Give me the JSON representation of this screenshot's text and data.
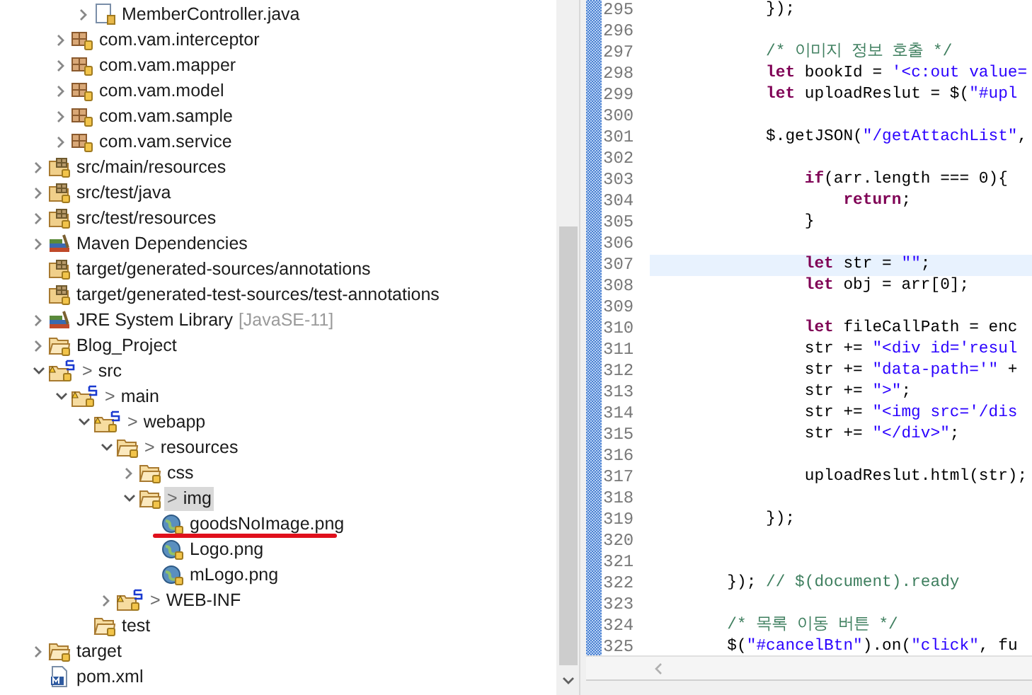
{
  "explorer": {
    "items": [
      {
        "children": [
          {
            "children": [
              {
                "children": [
                  {
                    "label": "MemberController.java",
                    "kind": "java",
                    "expanded": false,
                    "selected": false
                  }
                ]
              },
              {
                "label": "com.vam.interceptor",
                "kind": "package",
                "expanded": false,
                "selected": false
              },
              {
                "label": "com.vam.mapper",
                "kind": "package",
                "expanded": false,
                "selected": false
              },
              {
                "label": "com.vam.model",
                "kind": "package",
                "expanded": false,
                "selected": false
              },
              {
                "label": "com.vam.sample",
                "kind": "package",
                "expanded": false,
                "selected": false
              },
              {
                "label": "com.vam.service",
                "kind": "package",
                "expanded": false,
                "selected": false
              }
            ]
          },
          {
            "label": "src/main/resources",
            "kind": "source-folder",
            "expanded": false,
            "selected": false
          },
          {
            "label": "src/test/java",
            "kind": "source-folder",
            "expanded": false,
            "selected": false
          },
          {
            "label": "src/test/resources",
            "kind": "source-folder",
            "expanded": false,
            "selected": false
          },
          {
            "label": "Maven Dependencies",
            "kind": "library",
            "expanded": false,
            "selected": false
          },
          {
            "label": "target/generated-sources/annotations",
            "kind": "source-folder",
            "selected": false
          },
          {
            "label": "target/generated-test-sources/test-annotations",
            "kind": "source-folder",
            "selected": false
          },
          {
            "label": "JRE System Library",
            "decoration": "[JavaSE-11]",
            "kind": "library",
            "expanded": false,
            "selected": false
          },
          {
            "label": "Blog_Project",
            "kind": "folder",
            "expanded": false,
            "selected": false
          },
          {
            "label": "src",
            "prefix": ">",
            "kind": "web-folder",
            "expanded": true,
            "selected": false,
            "children": [
              {
                "label": "main",
                "prefix": ">",
                "kind": "web-folder",
                "expanded": true,
                "selected": false,
                "children": [
                  {
                    "label": "webapp",
                    "prefix": ">",
                    "kind": "web-folder",
                    "expanded": true,
                    "selected": false,
                    "children": [
                      {
                        "label": "resources",
                        "prefix": ">",
                        "kind": "folder",
                        "expanded": true,
                        "selected": false,
                        "children": [
                          {
                            "label": "css",
                            "kind": "folder",
                            "expanded": false,
                            "selected": false
                          },
                          {
                            "label": "img",
                            "prefix": ">",
                            "kind": "folder",
                            "expanded": true,
                            "selected": true,
                            "children": [
                              {
                                "label": "goodsNoImage.png",
                                "kind": "image",
                                "selected": false,
                                "annotated": true
                              },
                              {
                                "label": "Logo.png",
                                "kind": "image",
                                "selected": false
                              },
                              {
                                "label": "mLogo.png",
                                "kind": "image",
                                "selected": false
                              }
                            ]
                          }
                        ]
                      },
                      {
                        "label": "WEB-INF",
                        "prefix": ">",
                        "kind": "web-folder",
                        "expanded": false,
                        "selected": false
                      }
                    ]
                  },
                  {
                    "label": "test",
                    "kind": "folder",
                    "selected": false
                  }
                ]
              }
            ]
          },
          {
            "label": "target",
            "kind": "folder",
            "expanded": false,
            "selected": false
          },
          {
            "label": "pom.xml",
            "kind": "xml",
            "selected": false
          }
        ]
      }
    ]
  },
  "editor": {
    "lines": [
      {
        "number": "295",
        "segments": [
          {
            "kind": "plain",
            "text": "            });"
          }
        ]
      },
      {
        "number": "296"
      },
      {
        "number": "297",
        "segments": [
          {
            "kind": "comment",
            "text": "            /* 이미지 정보 호출 */"
          }
        ]
      },
      {
        "number": "298",
        "segments": [
          {
            "kind": "kw",
            "text": "            let"
          },
          {
            "kind": "plain",
            "text": " bookId = "
          },
          {
            "kind": "str",
            "text": "'<c:out value="
          }
        ]
      },
      {
        "number": "299",
        "segments": [
          {
            "kind": "kw",
            "text": "            let"
          },
          {
            "kind": "plain",
            "text": " uploadReslut = $("
          },
          {
            "kind": "str",
            "text": "\"#upl"
          }
        ]
      },
      {
        "number": "300"
      },
      {
        "number": "301",
        "segments": [
          {
            "kind": "plain",
            "text": "            $.getJSON("
          },
          {
            "kind": "str",
            "text": "\"/getAttachList\""
          },
          {
            "kind": "plain",
            "text": ","
          }
        ]
      },
      {
        "number": "302"
      },
      {
        "number": "303",
        "segments": [
          {
            "kind": "kw",
            "text": "                if"
          },
          {
            "kind": "plain",
            "text": "(arr.length === 0){"
          }
        ]
      },
      {
        "number": "304",
        "segments": [
          {
            "kind": "kw",
            "text": "                    return"
          },
          {
            "kind": "plain",
            "text": ";"
          }
        ]
      },
      {
        "number": "305",
        "segments": [
          {
            "kind": "plain",
            "text": "                }"
          }
        ]
      },
      {
        "number": "306"
      },
      {
        "number": "307",
        "current": true,
        "segments": [
          {
            "kind": "kw",
            "text": "                let"
          },
          {
            "kind": "plain",
            "text": " str = "
          },
          {
            "kind": "str",
            "text": "\"\""
          },
          {
            "kind": "plain",
            "text": ";"
          }
        ]
      },
      {
        "number": "308",
        "segments": [
          {
            "kind": "kw",
            "text": "                let"
          },
          {
            "kind": "plain",
            "text": " obj = arr[0];"
          }
        ]
      },
      {
        "number": "309"
      },
      {
        "number": "310",
        "segments": [
          {
            "kind": "kw",
            "text": "                let"
          },
          {
            "kind": "plain",
            "text": " fileCallPath = enc"
          }
        ]
      },
      {
        "number": "311",
        "segments": [
          {
            "kind": "plain",
            "text": "                str += "
          },
          {
            "kind": "str",
            "text": "\"<div id='resul"
          }
        ]
      },
      {
        "number": "312",
        "segments": [
          {
            "kind": "plain",
            "text": "                str += "
          },
          {
            "kind": "str",
            "text": "\"data-path='\""
          },
          {
            "kind": "plain",
            "text": " +"
          }
        ]
      },
      {
        "number": "313",
        "segments": [
          {
            "kind": "plain",
            "text": "                str += "
          },
          {
            "kind": "str",
            "text": "\">\""
          },
          {
            "kind": "plain",
            "text": ";"
          }
        ]
      },
      {
        "number": "314",
        "segments": [
          {
            "kind": "plain",
            "text": "                str += "
          },
          {
            "kind": "str",
            "text": "\"<img src='/dis"
          }
        ]
      },
      {
        "number": "315",
        "segments": [
          {
            "kind": "plain",
            "text": "                str += "
          },
          {
            "kind": "str",
            "text": "\"</div>\""
          },
          {
            "kind": "plain",
            "text": ";"
          }
        ]
      },
      {
        "number": "316"
      },
      {
        "number": "317",
        "segments": [
          {
            "kind": "plain",
            "text": "                uploadReslut.html(str);"
          }
        ]
      },
      {
        "number": "318"
      },
      {
        "number": "319",
        "segments": [
          {
            "kind": "plain",
            "text": "            });"
          }
        ]
      },
      {
        "number": "320"
      },
      {
        "number": "321"
      },
      {
        "number": "322",
        "segments": [
          {
            "kind": "plain",
            "text": "        }); "
          },
          {
            "kind": "comment",
            "text": "// $(document).ready"
          }
        ]
      },
      {
        "number": "323"
      },
      {
        "number": "324",
        "segments": [
          {
            "kind": "comment",
            "text": "        /* 목록 이동 버튼 */"
          }
        ]
      },
      {
        "number": "325",
        "segments": [
          {
            "kind": "plain",
            "text": "        $("
          },
          {
            "kind": "str",
            "text": "\"#cancelBtn\""
          },
          {
            "kind": "plain",
            "text": ").on("
          },
          {
            "kind": "str",
            "text": "\"click\""
          },
          {
            "kind": "plain",
            "text": ", fu"
          }
        ]
      }
    ]
  }
}
